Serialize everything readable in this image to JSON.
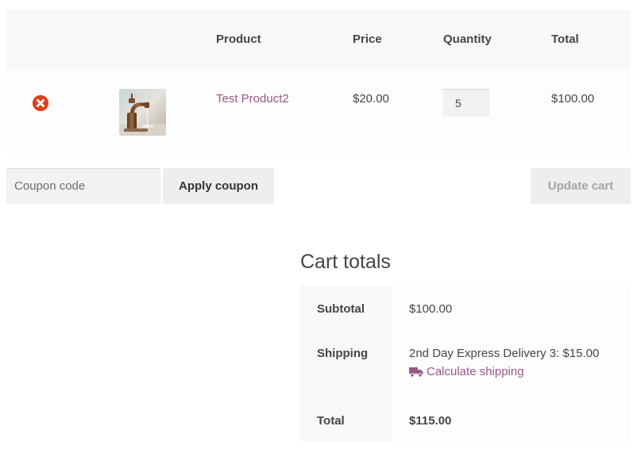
{
  "cart": {
    "headers": {
      "product": "Product",
      "price": "Price",
      "quantity": "Quantity",
      "total": "Total"
    },
    "items": [
      {
        "name": "Test Product2",
        "price": "$20.00",
        "quantity": "5",
        "total": "$100.00",
        "remove_icon": "remove-circle-icon",
        "thumbnail": "faucet-product-image"
      }
    ]
  },
  "actions": {
    "coupon_placeholder": "Coupon code",
    "apply_coupon_label": "Apply coupon",
    "update_cart_label": "Update cart"
  },
  "totals": {
    "title": "Cart totals",
    "subtotal_label": "Subtotal",
    "subtotal_value": "$100.00",
    "shipping_label": "Shipping",
    "shipping_value": "2nd Day Express Delivery 3: $15.00",
    "calculate_shipping_label": "Calculate shipping",
    "calculate_shipping_icon": "truck-icon",
    "total_label": "Total",
    "total_value": "$115.00"
  },
  "colors": {
    "link": "#96588a",
    "remove": "#e2401c",
    "header_bg": "#f8f8f8",
    "button_bg": "#eeeeee",
    "disabled_text": "#a5a5a5"
  }
}
